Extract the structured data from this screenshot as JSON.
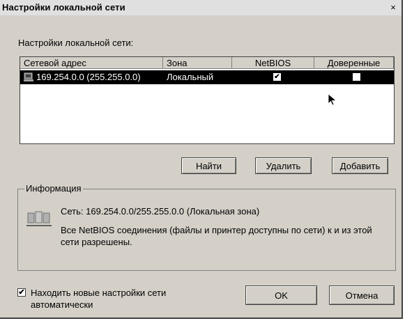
{
  "window": {
    "title": "Настройки локальной сети",
    "close_glyph": "×"
  },
  "section_label": "Настройки локальной сети:",
  "table": {
    "columns": [
      "Сетевой адрес",
      "Зона",
      "NetBIOS",
      "Доверенные"
    ],
    "rows": [
      {
        "address": "169.254.0.0 (255.255.0.0)",
        "zone": "Локальный",
        "netbios": "✔",
        "trusted": ""
      }
    ],
    "row_icon": "network-icon"
  },
  "buttons": {
    "find": "Найти",
    "delete": "Удалить",
    "add": "Добавить",
    "ok": "OK",
    "cancel": "Отмена"
  },
  "info": {
    "title": "Информация",
    "icon": "network-info-icon",
    "line1": "Сеть: 169.254.0.0/255.255.0.0 (Локальная зона)",
    "line2": "Все NetBIOS соединения (файлы и принтер доступны по сети) к и из этой сети разрешены."
  },
  "auto_detect": {
    "checked_glyph": "✔",
    "label": "Находить новые настройки сети автоматически"
  },
  "colors": {
    "dialog_bg": "#d4d0c8",
    "selection_bg": "#000000",
    "selection_fg": "#ffffff"
  }
}
